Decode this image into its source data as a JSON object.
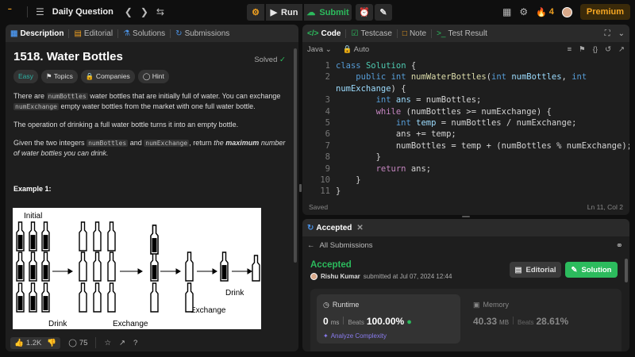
{
  "topbar": {
    "title": "Daily Question",
    "run_label": "Run",
    "submit_label": "Submit",
    "streak_count": "4",
    "premium_label": "Premium"
  },
  "left_panel": {
    "tabs": [
      "Description",
      "Editorial",
      "Solutions",
      "Submissions"
    ],
    "problem_title": "1518. Water Bottles",
    "solved_label": "Solved",
    "tags": [
      "Easy",
      "Topics",
      "Companies",
      "Hint"
    ],
    "para1_a": "There are ",
    "para1_code1": "numBottles",
    "para1_b": " water bottles that are initially full of water. You can exchange ",
    "para1_code2": "numExchange",
    "para1_c": " empty water bottles from the market with one full water bottle.",
    "para2": "The operation of drinking a full water bottle turns it into an empty bottle.",
    "para3_a": "Given the two integers ",
    "para3_code1": "numBottles",
    "para3_b": " and ",
    "para3_code2": "numExchange",
    "para3_c": ", return ",
    "para3_d": "the ",
    "para3_e": "maximum",
    "para3_f": " number of water bottles you can drink.",
    "example_heading": "Example 1:",
    "figure_labels": {
      "initial": "Initial",
      "drink_bottom": "Drink",
      "exchange_bottom": "Exchange",
      "exchange_mid": "Exchange",
      "drink_right": "Drink"
    },
    "footer": {
      "likes": "1.2K",
      "comments": "75"
    }
  },
  "code_panel": {
    "tabs": [
      "Code",
      "Testcase",
      "Note",
      "Test Result"
    ],
    "language": "Java",
    "auto_label": "Auto",
    "status": "Saved",
    "cursor": "Ln 11, Col 2",
    "line_numbers": [
      "1",
      "2",
      "",
      "3",
      "4",
      "5",
      "6",
      "7",
      "8",
      "9",
      "10",
      "11"
    ]
  },
  "result_panel": {
    "tab_label": "Accepted",
    "back_label": "All Submissions",
    "status": "Accepted",
    "author": "Rishu Kumar",
    "submitted_text": "submitted at Jul 07, 2024 12:44",
    "editorial_label": "Editorial",
    "solution_label": "Solution",
    "runtime_label": "Runtime",
    "runtime_value": "0",
    "runtime_unit": "ms",
    "beats_label": "Beats",
    "runtime_beats": "100.00%",
    "analyze_label": "Analyze Complexity",
    "memory_label": "Memory",
    "memory_value": "40.33",
    "memory_unit": "MB",
    "memory_beats": "28.61%"
  },
  "colors": {
    "accent_orange": "#f0a020",
    "accepted_green": "#2cbb5d",
    "easy_teal": "#2cb3a5"
  }
}
